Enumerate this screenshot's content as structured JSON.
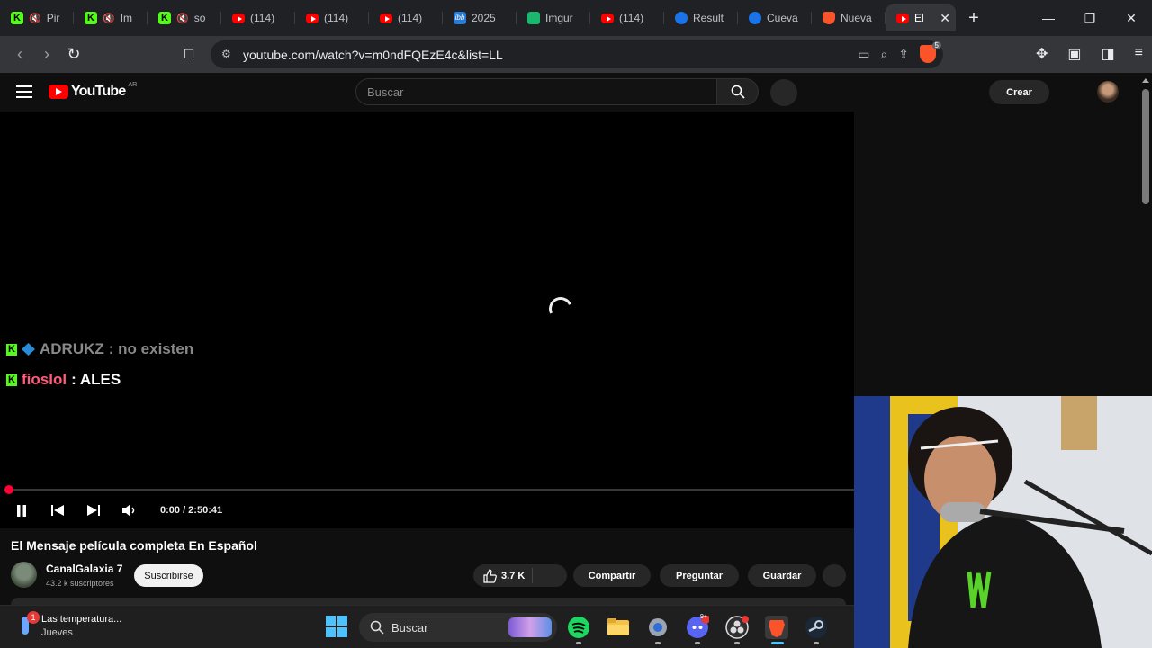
{
  "browser": {
    "tabs": [
      {
        "label": "Pir",
        "icon": "kick-icon",
        "muted": true
      },
      {
        "label": "Im",
        "icon": "kick-icon",
        "muted": true
      },
      {
        "label": "so",
        "icon": "kick-icon",
        "muted": true
      },
      {
        "label": "(114)",
        "icon": "youtube-icon"
      },
      {
        "label": "(114)",
        "icon": "youtube-icon"
      },
      {
        "label": "(114)",
        "icon": "youtube-icon"
      },
      {
        "label": "2025",
        "icon": "ibb-icon"
      },
      {
        "label": "Imgur",
        "icon": "imgur-icon"
      },
      {
        "label": "(114)",
        "icon": "youtube-icon"
      },
      {
        "label": "Result",
        "icon": "edge-icon"
      },
      {
        "label": "Cueva",
        "icon": "edge-icon"
      },
      {
        "label": "Nueva",
        "icon": "brave-icon"
      },
      {
        "label": "El",
        "icon": "youtube-icon",
        "active": true
      }
    ],
    "url": "youtube.com/watch?v=m0ndFQEzE4c&list=LL",
    "shield_count": "5"
  },
  "youtube": {
    "logo": "YouTube",
    "region": "AR",
    "search_placeholder": "Buscar",
    "create_label": "Crear"
  },
  "player": {
    "chat": [
      {
        "user": "ADRUKZ",
        "message": ": no existen"
      },
      {
        "user": "fioslol",
        "message": ": ALES"
      }
    ],
    "time": "0:00 / 2:50:41",
    "progress_fraction": 0.0
  },
  "video": {
    "title": "El Mensaje película completa En Español",
    "channel": "CanalGalaxia 7",
    "subscribers": "43.2 k suscriptores",
    "subscribe_label": "Suscribirse",
    "likes": "3.7 K",
    "share_label": "Compartir",
    "ask_label": "Preguntar",
    "save_label": "Guardar"
  },
  "taskbar": {
    "weather_title": "Las temperatura...",
    "weather_day": "Jueves",
    "notification_count": "1",
    "search_label": "Buscar",
    "discord_badge": "9+"
  },
  "colors": {
    "accent_red": "#ff0033",
    "kick_green": "#53fc18",
    "chat_user1": "#b6262a",
    "chat_user2": "#ff5c7a"
  }
}
